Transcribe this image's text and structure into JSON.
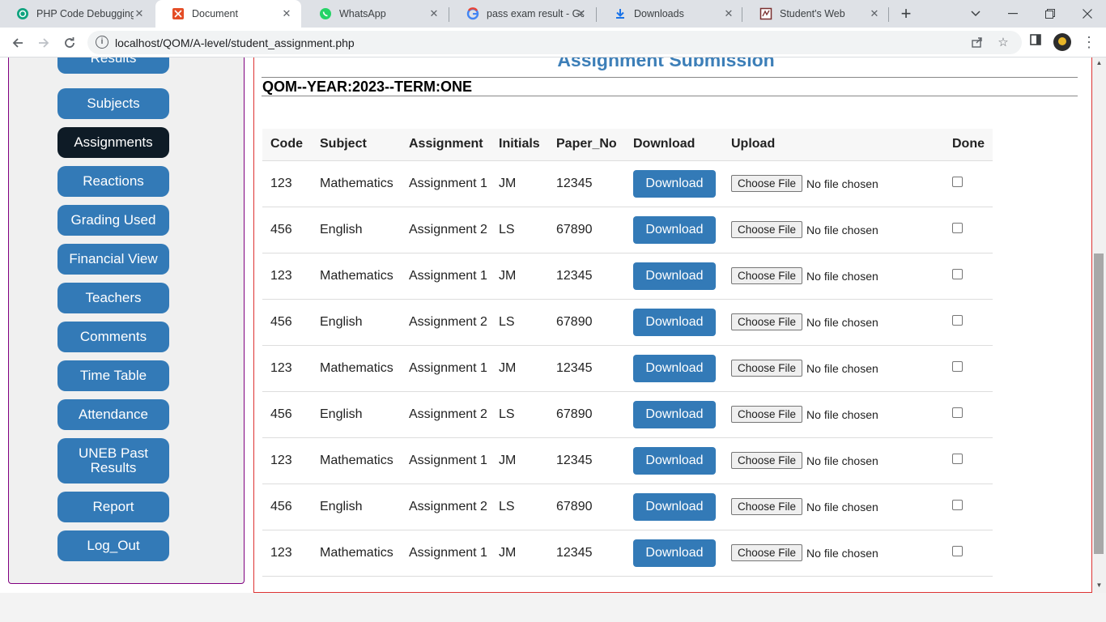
{
  "browser": {
    "tabs": [
      {
        "title": "PHP Code Debugging",
        "icon": "chatgpt-icon",
        "active": false
      },
      {
        "title": "Document",
        "icon": "document-icon",
        "active": true
      },
      {
        "title": "WhatsApp",
        "icon": "whatsapp-icon",
        "active": false
      },
      {
        "title": "pass exam result - Goo",
        "icon": "google-icon",
        "active": false
      },
      {
        "title": "Downloads",
        "icon": "download-icon",
        "active": false
      },
      {
        "title": "Student's Web",
        "icon": "web-icon",
        "active": false
      }
    ],
    "url": "localhost/QOM/A-level/student_assignment.php"
  },
  "sidebar": {
    "items": [
      {
        "label": "Results"
      },
      {
        "label": "Subjects"
      },
      {
        "label": "Assignments"
      },
      {
        "label": "Reactions"
      },
      {
        "label": "Grading Used"
      },
      {
        "label": "Financial View"
      },
      {
        "label": "Teachers"
      },
      {
        "label": "Comments"
      },
      {
        "label": "Time Table"
      },
      {
        "label": "Attendance"
      },
      {
        "label": "UNEB Past Results"
      },
      {
        "label": "Report"
      },
      {
        "label": "Log_Out"
      }
    ],
    "active": "Assignments"
  },
  "main": {
    "title": "Assignment Submission",
    "term": "QOM--YEAR:2023--TERM:ONE",
    "table": {
      "headers": [
        "Code",
        "Subject",
        "Assignment",
        "Initials",
        "Paper_No",
        "Download",
        "Upload",
        "Done"
      ],
      "download_label": "Download",
      "choose_label": "Choose File",
      "no_file_label": "No file chosen",
      "rows": [
        {
          "code": "123",
          "subject": "Mathematics",
          "assignment": "Assignment 1",
          "initials": "JM",
          "paper": "12345"
        },
        {
          "code": "456",
          "subject": "English",
          "assignment": "Assignment 2",
          "initials": "LS",
          "paper": "67890"
        },
        {
          "code": "123",
          "subject": "Mathematics",
          "assignment": "Assignment 1",
          "initials": "JM",
          "paper": "12345"
        },
        {
          "code": "456",
          "subject": "English",
          "assignment": "Assignment 2",
          "initials": "LS",
          "paper": "67890"
        },
        {
          "code": "123",
          "subject": "Mathematics",
          "assignment": "Assignment 1",
          "initials": "JM",
          "paper": "12345"
        },
        {
          "code": "456",
          "subject": "English",
          "assignment": "Assignment 2",
          "initials": "LS",
          "paper": "67890"
        },
        {
          "code": "123",
          "subject": "Mathematics",
          "assignment": "Assignment 1",
          "initials": "JM",
          "paper": "12345"
        },
        {
          "code": "456",
          "subject": "English",
          "assignment": "Assignment 2",
          "initials": "LS",
          "paper": "67890"
        },
        {
          "code": "123",
          "subject": "Mathematics",
          "assignment": "Assignment 1",
          "initials": "JM",
          "paper": "12345"
        }
      ]
    }
  },
  "colors": {
    "accent": "#337ab7",
    "active_nav": "#0e1b26",
    "title": "#3d7fb8",
    "main_border": "#dd3333",
    "sidebar_border": "#800080"
  }
}
